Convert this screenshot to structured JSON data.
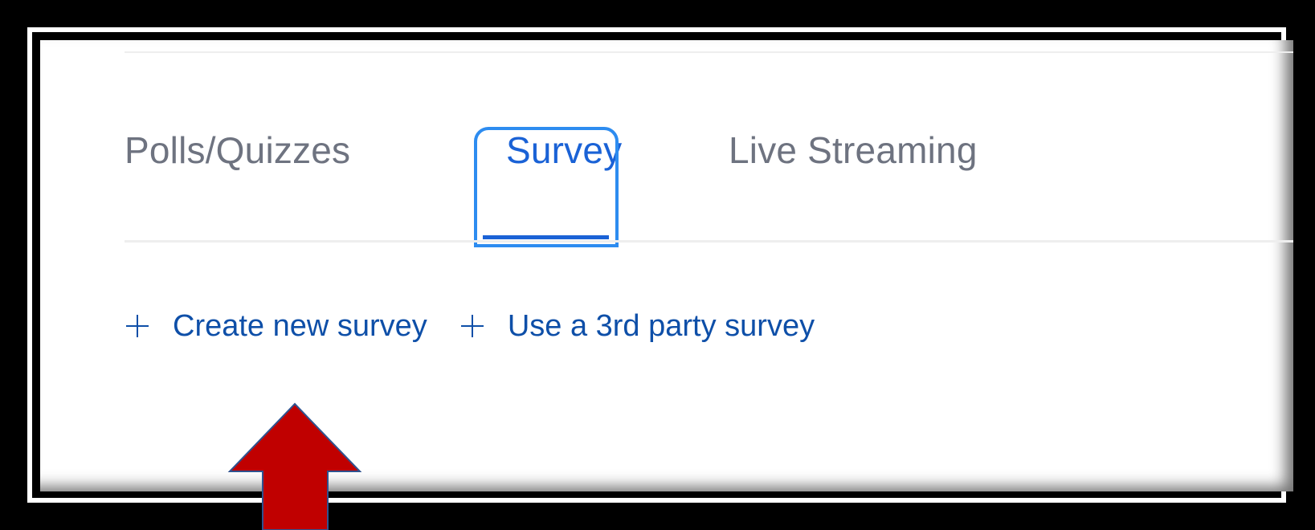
{
  "tabs": [
    {
      "label": "Polls/Quizzes",
      "active": false
    },
    {
      "label": "Survey",
      "active": true
    },
    {
      "label": "Live Streaming",
      "active": false
    }
  ],
  "actions": {
    "create_survey": {
      "icon": "plus-icon",
      "label": "Create new survey"
    },
    "third_party": {
      "icon": "plus-icon",
      "label": "Use a 3rd party survey"
    }
  },
  "colors": {
    "frame_bg": "#000000",
    "panel_bg": "#ffffff",
    "tab_inactive": "#6e7380",
    "tab_active": "#1a62d6",
    "tab_highlight_border": "#2d8cf0",
    "action_link": "#0e4fa8",
    "arrow_fill": "#c00000",
    "arrow_stroke": "#2f528f"
  },
  "annotation": {
    "icon": "up-arrow-icon"
  }
}
